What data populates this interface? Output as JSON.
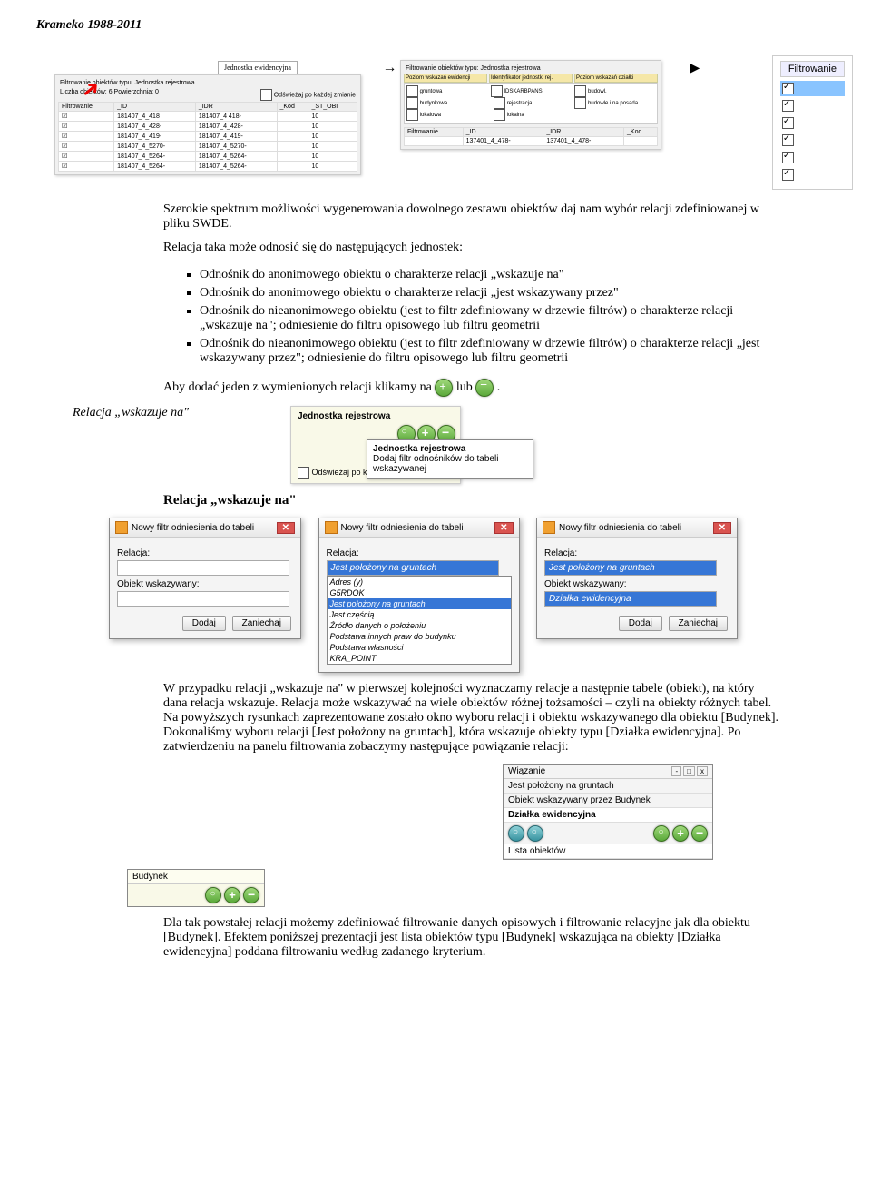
{
  "header": "Krameko 1988-2011",
  "filtrowanie_panel": {
    "title": "Filtrowanie",
    "rows": 6
  },
  "panel1": {
    "title_above": "Jednostka ewidencyjna",
    "title": "Filtrowanie obiektów typu: Jednostka rejestrowa",
    "stats": "Liczba obiektów: 6     Powierzchnia: 0",
    "refresh": "Odświeżaj po każdej zmianie",
    "columns": [
      "Filtrowanie",
      "_ID",
      "_IDR",
      "_Kod",
      "_ST_OBI"
    ],
    "rows": [
      [
        "☑",
        "181407_4_418",
        "181407_4 418-",
        "",
        "10"
      ],
      [
        "☑",
        "181407_4_428-",
        "181407_4_428-",
        "",
        "10"
      ],
      [
        "☑",
        "181407_4_419-",
        "181407_4_419-",
        "",
        "10"
      ],
      [
        "☑",
        "181407_4_5270-",
        "181407_4_5270-",
        "",
        "10"
      ],
      [
        "☑",
        "181407_4_5264-",
        "181407_4_5264-",
        "",
        "10"
      ],
      [
        "☑",
        "181407_4_5264-",
        "181407_4_5264-",
        "",
        "10"
      ]
    ]
  },
  "panel2": {
    "title": "Filtrowanie obiektów typu: Jednostka rejestrowa",
    "tabs": [
      "Poziom wskazań ewidencji",
      "Identyfikator jednostki rej.",
      "Poziom wskazań działki"
    ],
    "groups": [
      [
        "gruntowa",
        "budynkowa",
        "lokalowa"
      ],
      [
        "IDSKARBPANS",
        "rejestracja",
        "lokalna"
      ],
      [
        "budowl.",
        "budowle i na posada"
      ]
    ],
    "grid": {
      "cols": [
        "Filtrowanie",
        "_ID",
        "_IDR",
        "_Kod"
      ],
      "row": [
        "",
        "137401_4_478-",
        "137401_4_478-",
        ""
      ]
    }
  },
  "intro": {
    "p1": "Szerokie spektrum możliwości wygenerowania dowolnego zestawu obiektów daj nam wybór relacji zdefiniowanej w pliku SWDE.",
    "p2": "Relacja taka może odnosić się do następujących jednostek:",
    "bullets": [
      "Odnośnik do anonimowego obiektu o charakterze relacji „wskazuje na\"",
      "Odnośnik do anonimowego obiektu o charakterze relacji „jest wskazywany przez\"",
      "Odnośnik do nieanonimowego obiektu (jest to filtr zdefiniowany w drzewie filtrów) o charakterze relacji „wskazuje na\"; odniesienie do filtru opisowego lub filtru geometrii",
      "Odnośnik do nieanonimowego obiektu (jest to filtr zdefiniowany w drzewie filtrów) o charakterze relacji „jest wskazywany przez\"; odniesienie do filtru opisowego lub filtru geometrii"
    ],
    "p3a": "Aby dodać jeden z wymienionych relacji klikamy na ",
    "p3b": " lub ",
    "p3c": "."
  },
  "margin_note": "Relacja „wskazuje na\"",
  "jr_panel": {
    "title": "Jednostka rejestrowa",
    "tooltip_title": "Jednostka rejestrowa",
    "tooltip_text": "Dodaj filtr odnośników do tabeli wskazywanej",
    "checkbox_label": "Odświeżaj po każdej zmianie"
  },
  "heading2": "Relacja „wskazuje na\"",
  "dialog1": {
    "title": "Nowy filtr odniesienia do tabeli",
    "lbl_rel": "Relacja:",
    "lbl_obj": "Obiekt wskazywany:",
    "btn_add": "Dodaj",
    "btn_cancel": "Zaniechaj"
  },
  "dialog2": {
    "title": "Nowy filtr odniesienia do tabeli",
    "lbl_rel": "Relacja:",
    "selected": "Jest położony na gruntach",
    "options": [
      "Adres (y)",
      "G5RDOK",
      "Jest położony na gruntach",
      "Jest częścią",
      "Źródło danych o położeniu",
      "Podstawa innych praw do budynku",
      "Podstawa własności",
      "KRA_POINT"
    ],
    "sel_index": 2
  },
  "dialog3": {
    "title": "Nowy filtr odniesienia do tabeli",
    "lbl_rel": "Relacja:",
    "rel_val": "Jest położony na gruntach",
    "lbl_obj": "Obiekt wskazywany:",
    "obj_val": "Działka ewidencyjna",
    "btn_add": "Dodaj",
    "btn_cancel": "Zaniechaj"
  },
  "para_mid": "W przypadku relacji „wskazuje na\" w pierwszej kolejności wyznaczamy relacje a następnie tabele (obiekt), na który dana relacja wskazuje. Relacja może wskazywać na wiele obiektów różnej tożsamości – czyli na obiekty różnych tabel.\nNa powyższych rysunkach zaprezentowane zostało okno wyboru relacji i obiektu wskazywanego dla obiektu [Budynek]. Dokonaliśmy wyboru relacji [Jest położony na gruntach], która wskazuje obiekty typu [Działka ewidencyjna]. Po zatwierdzeniu na panelu filtrowania zobaczymy następujące powiązanie relacji:",
  "wiazanie": {
    "title": "Wiązanie",
    "r1": "Jest położony na gruntach",
    "r2": "Obiekt wskazywany przez Budynek",
    "r3": "Działka ewidencyjna",
    "r4": "Lista obiektów"
  },
  "budynek": {
    "title": "Budynek"
  },
  "para_end": "Dla tak powstałej relacji możemy zdefiniować filtrowanie danych opisowych i filtrowanie relacyjne jak dla obiektu [Budynek]. Efektem poniższej prezentacji jest lista obiektów typu [Budynek] wskazująca na obiekty [Działka ewidencyjna] poddana filtrowaniu według zadanego kryterium."
}
